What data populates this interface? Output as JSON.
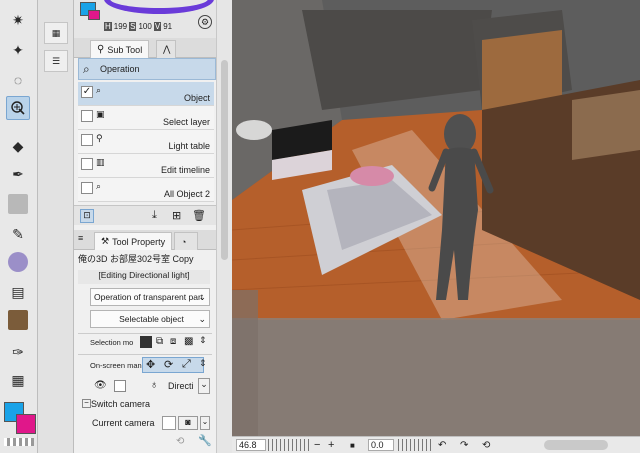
{
  "color": {
    "h": "199",
    "s": "100",
    "v": "91",
    "h_label": "H",
    "s_label": "S",
    "v_label": "V",
    "main": "#1aa3e8",
    "sub": "#e0178a"
  },
  "subtool_panel": {
    "tab_label": "Sub Tool",
    "group_label": "Operation",
    "items": [
      {
        "label": "Object",
        "checked": true
      },
      {
        "label": "Select layer",
        "checked": false
      },
      {
        "label": "Light table",
        "checked": false
      },
      {
        "label": "Edit timeline",
        "checked": false
      },
      {
        "label": "All Object 2",
        "checked": false
      }
    ]
  },
  "tool_property": {
    "tab_label": "Tool Property",
    "layer_name": "俺の3D お部屋302号室 Copy",
    "editing_label": "[Editing Directional light]",
    "mode_select": "Operation of transparent part",
    "selectable_select": "Selectable object",
    "selection_mode_label": "Selection mo",
    "onscreen_label": "On-screen man",
    "direction_label": "Directi",
    "switch_camera_label": "Switch camera",
    "current_camera_label": "Current camera"
  },
  "statusbar": {
    "zoom": "46.8",
    "rotation": "0.0"
  }
}
